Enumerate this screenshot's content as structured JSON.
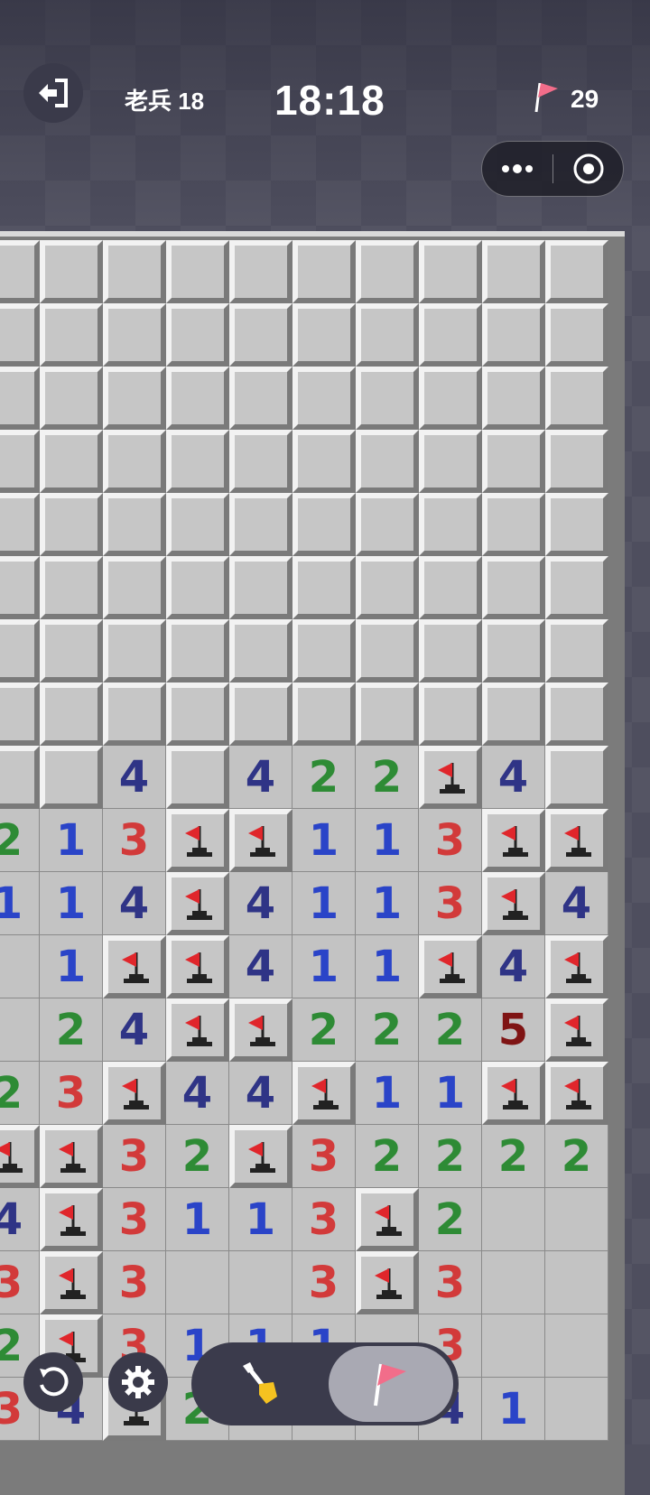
{
  "hud": {
    "level": "老兵 18",
    "timer": "18:18",
    "flags_left": "29"
  },
  "icons": {
    "exit": "exit-icon",
    "flag": "flag-icon",
    "more": "more-dots-icon",
    "close": "target-close-icon",
    "restart": "restart-icon",
    "settings": "gear-icon",
    "dig": "shovel-icon",
    "mark": "flag-mode-icon"
  },
  "colors": {
    "n1": "#2a44c8",
    "n2": "#2e8b35",
    "n3": "#d23a3a",
    "n4": "#2f3486",
    "n5": "#7f1414",
    "flag": "#e0262b"
  },
  "board": {
    "columns": 10,
    "legend": "C = closed, F = flagged, . = opened empty, digit = count",
    "rows": [
      "CCCCCCCCCC",
      "CCCCCCCCCC",
      "CCCCCCCCCC",
      "CCCCCCCCCC",
      "CCCCCCCCCC",
      "CCCCCCCCCC",
      "CCCCCCCCCC",
      "CCCCCCCCCC",
      "CC4C422F4C",
      "213FF113FF",
      "114F4113F4",
      ".1FF411F4F",
      ".24FF2225F",
      "23F44F11FF",
      "FF32F32222",
      "4F3113F2..",
      "3F3..3F3..",
      "2F3111.3..",
      "34F2...41."
    ]
  },
  "toolbar": {
    "selected": "mark"
  }
}
